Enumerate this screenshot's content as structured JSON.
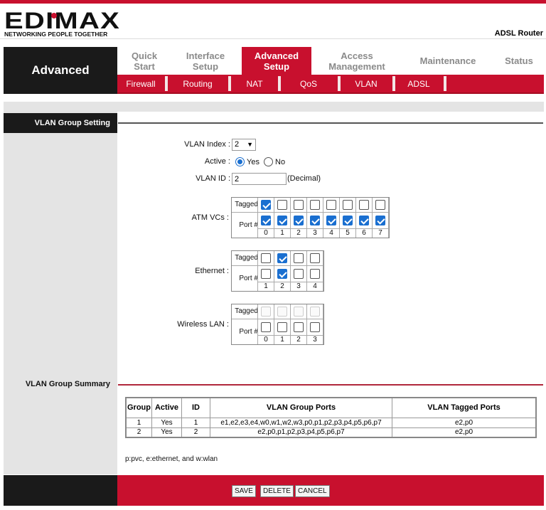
{
  "brand": {
    "logo_text": "EDIMAX",
    "tagline": "NETWORKING PEOPLE TOGETHER",
    "product": "ADSL Router",
    "accent_color": "#c8102e"
  },
  "section_title": "Advanced",
  "main_nav": [
    {
      "label": "Quick Start",
      "active": false
    },
    {
      "label": "Interface Setup",
      "active": false
    },
    {
      "label": "Advanced Setup",
      "active": true
    },
    {
      "label": "Access Management",
      "active": false
    },
    {
      "label": "Maintenance",
      "active": false
    },
    {
      "label": "Status",
      "active": false
    }
  ],
  "sub_nav": [
    "Firewall",
    "Routing",
    "NAT",
    "QoS",
    "VLAN",
    "ADSL"
  ],
  "vlan_setting": {
    "heading": "VLAN Group Setting",
    "index_label": "VLAN Index :",
    "index_value": "2",
    "active_label": "Active :",
    "active_yes": "Yes",
    "active_no": "No",
    "active_selected": "Yes",
    "id_label": "VLAN ID :",
    "id_value": "2",
    "id_unit": "(Decimal)",
    "tagged_label": "Tagged",
    "port_label": "Port #",
    "atm": {
      "label": "ATM VCs :",
      "ports": [
        "0",
        "1",
        "2",
        "3",
        "4",
        "5",
        "6",
        "7"
      ],
      "tagged": [
        true,
        false,
        false,
        false,
        false,
        false,
        false,
        false
      ],
      "member": [
        true,
        true,
        true,
        true,
        true,
        true,
        true,
        true
      ]
    },
    "ethernet": {
      "label": "Ethernet :",
      "ports": [
        "1",
        "2",
        "3",
        "4"
      ],
      "tagged": [
        false,
        true,
        false,
        false
      ],
      "member": [
        false,
        true,
        false,
        false
      ]
    },
    "wlan": {
      "label": "Wireless LAN :",
      "ports": [
        "0",
        "1",
        "2",
        "3"
      ],
      "tagged": [
        false,
        false,
        false,
        false
      ],
      "tagged_disabled": true,
      "member": [
        false,
        false,
        false,
        false
      ]
    }
  },
  "summary": {
    "heading": "VLAN Group Summary",
    "columns": [
      "Group",
      "Active",
      "ID",
      "VLAN Group Ports",
      "VLAN Tagged Ports"
    ],
    "rows": [
      [
        "1",
        "Yes",
        "1",
        "e1,e2,e3,e4,w0,w1,w2,w3,p0,p1,p2,p3,p4,p5,p6,p7",
        "e2,p0"
      ],
      [
        "2",
        "Yes",
        "2",
        "e2,p0,p1,p2,p3,p4,p5,p6,p7",
        "e2,p0"
      ]
    ],
    "legend": "p:pvc, e:ethernet, and w:wlan"
  },
  "buttons": {
    "save": "SAVE",
    "delete": "DELETE",
    "cancel": "CANCEL"
  }
}
